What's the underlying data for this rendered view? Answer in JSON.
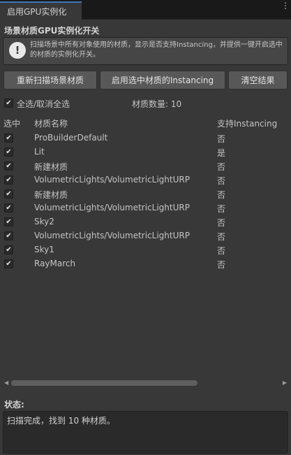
{
  "tab": {
    "title": "启用GPU实例化",
    "menu_glyph": "⋮"
  },
  "section_title": "场景材质GPU实例化开关",
  "help": {
    "icon": "info-icon",
    "icon_glyph": "!",
    "text": "扫描场景中所有对象使用的材质，显示是否支持Instancing，并提供一键开启选中的材质的实例化开关。"
  },
  "buttons": {
    "rescan": "重新扫描场景材质",
    "enable_selected": "启用选中材质的Instancing",
    "clear": "清空结果"
  },
  "select_all": {
    "label": "全选/取消全选",
    "checked": true,
    "check_glyph": "✔"
  },
  "material_count": "材质数量: 10",
  "table": {
    "headers": {
      "select": "选中",
      "name": "材质名称",
      "support": "支持Instancing"
    },
    "rows": [
      {
        "checked": true,
        "name": "ProBuilderDefault",
        "support": "否"
      },
      {
        "checked": true,
        "name": "Lit",
        "support": "是"
      },
      {
        "checked": true,
        "name": "新建材质",
        "support": "否"
      },
      {
        "checked": true,
        "name": "VolumetricLights/VolumetricLightURP",
        "support": "否"
      },
      {
        "checked": true,
        "name": "新建材质",
        "support": "否"
      },
      {
        "checked": true,
        "name": "VolumetricLights/VolumetricLightURP",
        "support": "否"
      },
      {
        "checked": true,
        "name": "Sky2",
        "support": "否"
      },
      {
        "checked": true,
        "name": "VolumetricLights/VolumetricLightURP",
        "support": "否"
      },
      {
        "checked": true,
        "name": "Sky1",
        "support": "否"
      },
      {
        "checked": true,
        "name": "RayMarch",
        "support": "否"
      }
    ]
  },
  "scrollbar": {
    "left_glyph": "◀",
    "right_glyph": "▶",
    "thumb_fraction": 0.66
  },
  "status": {
    "label": "状态:",
    "text": "扫描完成，找到 10 种材质。"
  },
  "colors": {
    "accent": "#3a79bb",
    "panel": "#383838",
    "button": "#585858"
  }
}
